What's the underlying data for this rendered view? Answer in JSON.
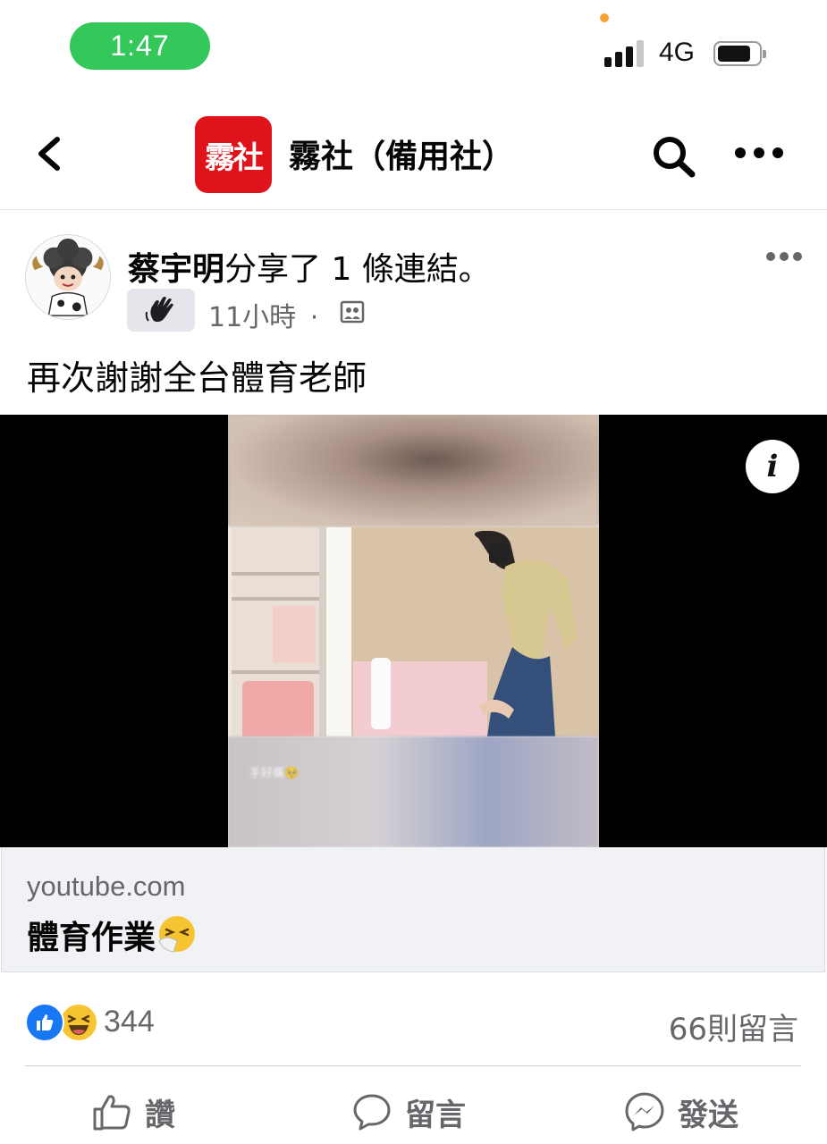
{
  "status_bar": {
    "time": "1:47",
    "network": "4G",
    "signal_bars": 3
  },
  "header": {
    "logo_text": "霧社",
    "title": "霧社（備用社）"
  },
  "post": {
    "author": "蔡宇明",
    "action_text": "分享了 1 條連結。",
    "time": "11小時",
    "separator": "·",
    "text": "再次謝謝全台體育老師",
    "video_overlay_text": "手好痛🥺"
  },
  "link": {
    "domain": "youtube.com",
    "title": "體育作業"
  },
  "engagement": {
    "reaction_count": "344",
    "comment_count": "66則留言"
  },
  "actions": {
    "like": "讚",
    "comment": "留言",
    "share": "發送"
  },
  "colors": {
    "facebook_blue": "#1877f2",
    "status_green": "#34c759",
    "logo_red": "#e0131a",
    "secondary_text": "#65676b"
  }
}
